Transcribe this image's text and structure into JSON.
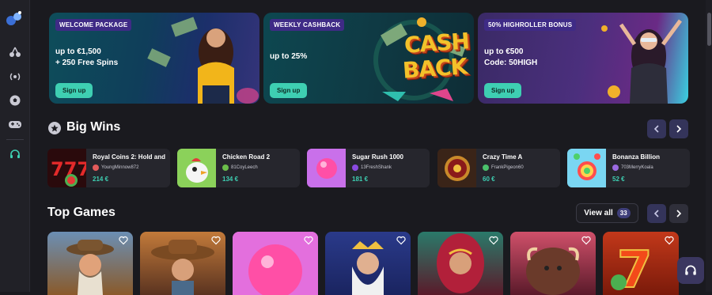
{
  "sidebar": {
    "icons": [
      "logo-icon",
      "cherries-icon",
      "broadcast-icon",
      "soccer-ball-icon",
      "gamepad-icon",
      "headset-icon"
    ]
  },
  "promos": [
    {
      "tag": "WELCOME PACKAGE",
      "line1": "up to €1,500",
      "line2": "+ 250 Free Spins",
      "button": "Sign up"
    },
    {
      "tag": "WEEKLY CASHBACK",
      "line1": "up to 25%",
      "line2": "",
      "button": "Sign up",
      "art_text_1": "CASH",
      "art_text_2": "BACK"
    },
    {
      "tag": "50% HIGHROLLER BONUS",
      "line1": "up to €500",
      "line2": "Code: 50HIGH",
      "button": "Sign up"
    }
  ],
  "big_wins": {
    "title": "Big Wins",
    "items": [
      {
        "game": "Royal Coins 2: Hold and",
        "user": "YoungMinnow872",
        "amount": "214 €"
      },
      {
        "game": "Chicken Road 2",
        "user": "81CoyLeech",
        "amount": "134 €"
      },
      {
        "game": "Sugar Rush 1000",
        "user": "13FreshShank",
        "amount": "181 €"
      },
      {
        "game": "Crazy Time A",
        "user": "FrankPigeon60",
        "amount": "60 €"
      },
      {
        "game": "Bonanza Billion",
        "user": "703MerryKoala",
        "amount": "52 €"
      }
    ]
  },
  "top_games": {
    "title": "Top Games",
    "view_all": "View all",
    "count": "33",
    "tiles": [
      "tile-1",
      "tile-2",
      "tile-3",
      "tile-4",
      "tile-5",
      "tile-6",
      "tile-7"
    ]
  },
  "colors": {
    "accent": "#3ecfb2",
    "tag_bg": "#3f2b86",
    "bg": "#1a1a1f",
    "card": "#26262d"
  }
}
